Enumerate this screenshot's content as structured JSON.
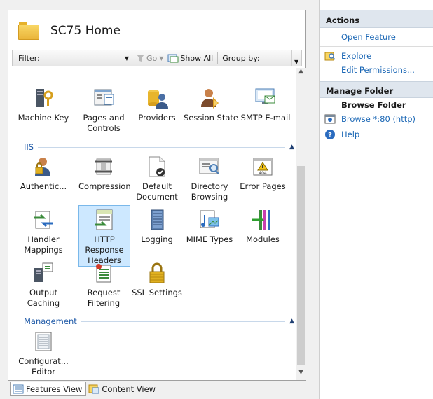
{
  "header": {
    "title": "SC75 Home"
  },
  "filter": {
    "label": "Filter:",
    "value": "",
    "go": "Go",
    "show_all": "Show All",
    "group_by": "Group by:"
  },
  "features_top": [
    {
      "name": "machine-key",
      "label": "Machine Key",
      "icon": "machine-key-icon"
    },
    {
      "name": "pages-controls",
      "label": "Pages and Controls",
      "icon": "pages-controls-icon"
    },
    {
      "name": "providers",
      "label": "Providers",
      "icon": "providers-icon"
    },
    {
      "name": "session-state",
      "label": "Session State",
      "icon": "session-state-icon"
    },
    {
      "name": "smtp-email",
      "label": "SMTP E-mail",
      "icon": "smtp-email-icon"
    }
  ],
  "sections": {
    "iis": "IIS",
    "management": "Management"
  },
  "features_iis": [
    {
      "label": "Authentic...",
      "icon": "authentication-icon"
    },
    {
      "label": "Compression",
      "icon": "compression-icon"
    },
    {
      "label": "Default Document",
      "icon": "default-document-icon"
    },
    {
      "label": "Directory Browsing",
      "icon": "directory-browsing-icon"
    },
    {
      "label": "Error Pages",
      "icon": "error-pages-icon"
    },
    {
      "label": "Handler Mappings",
      "icon": "handler-mappings-icon"
    },
    {
      "label": "HTTP Response Headers",
      "icon": "http-response-headers-icon",
      "selected": true
    },
    {
      "label": "Logging",
      "icon": "logging-icon"
    },
    {
      "label": "MIME Types",
      "icon": "mime-types-icon"
    },
    {
      "label": "Modules",
      "icon": "modules-icon"
    },
    {
      "label": "Output Caching",
      "icon": "output-caching-icon"
    },
    {
      "label": "Request Filtering",
      "icon": "request-filtering-icon"
    },
    {
      "label": "SSL Settings",
      "icon": "ssl-settings-icon"
    }
  ],
  "features_management": [
    {
      "label": "Configurat... Editor",
      "icon": "configuration-editor-icon"
    }
  ],
  "view_tabs": {
    "features": "Features View",
    "content": "Content View"
  },
  "actions": {
    "title": "Actions",
    "open_feature": "Open Feature",
    "explore": "Explore",
    "edit_permissions": "Edit Permissions...",
    "manage_folder": "Manage Folder",
    "browse_folder": "Browse Folder",
    "browse_80": "Browse *:80 (http)",
    "help": "Help"
  }
}
